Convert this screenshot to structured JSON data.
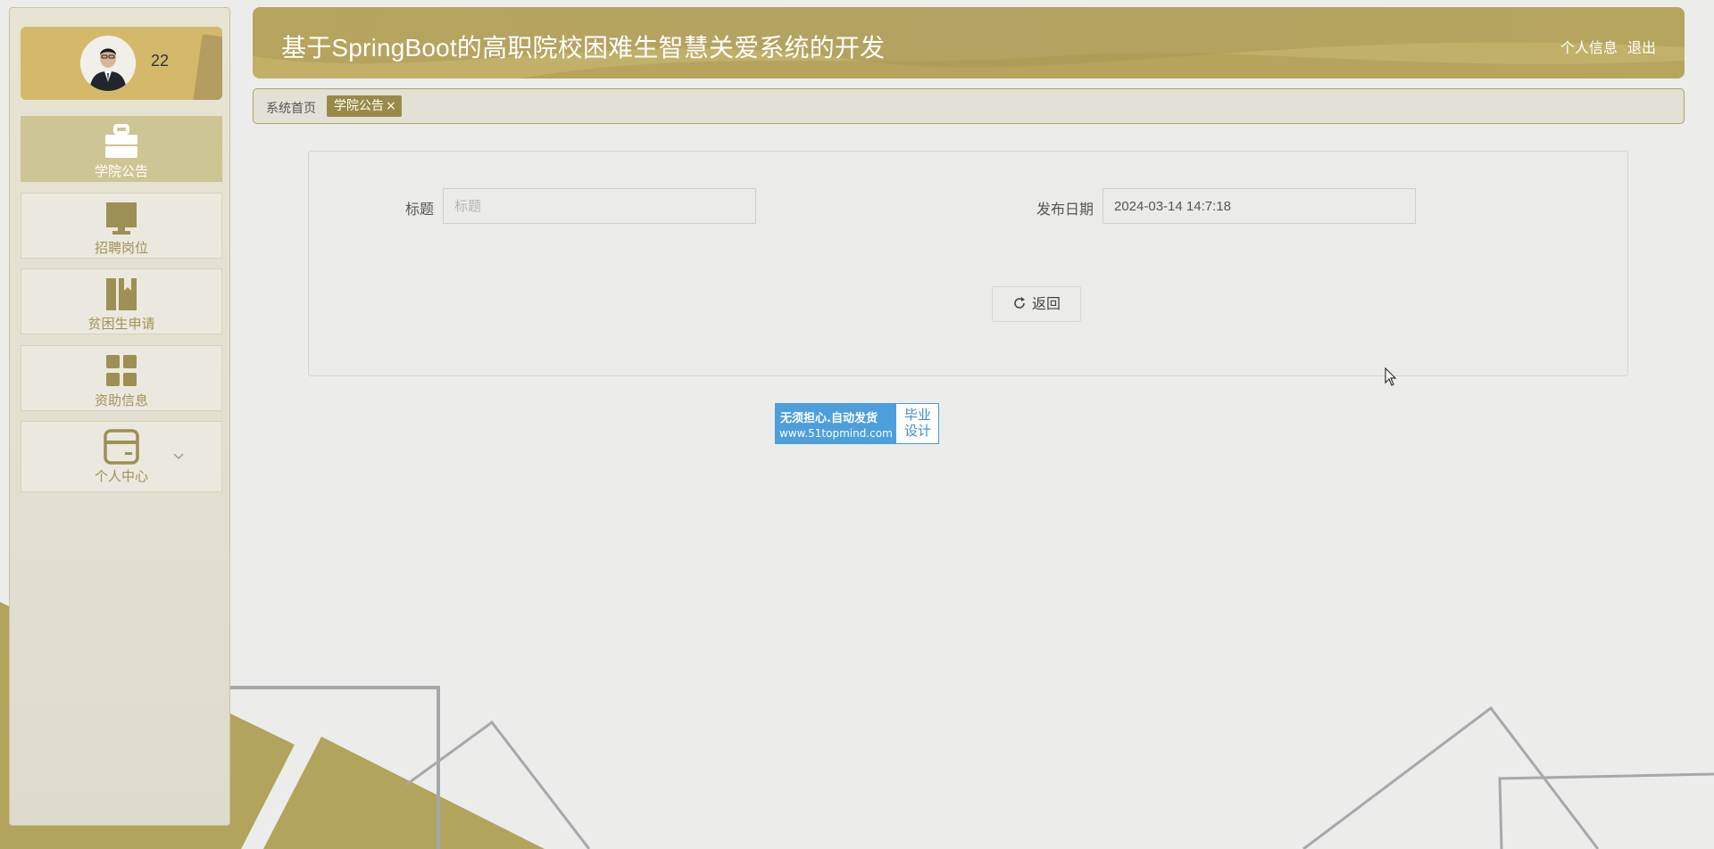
{
  "app": {
    "title": "基于SpringBoot的高职院校困难生智慧关爱系统的开发",
    "header_links": {
      "profile": "个人信息",
      "logout": "退出"
    }
  },
  "user": {
    "name": "22"
  },
  "sidebar": {
    "items": [
      {
        "label": "学院公告",
        "icon": "briefcase-icon",
        "active": true
      },
      {
        "label": "招聘岗位",
        "icon": "monitor-icon",
        "active": false
      },
      {
        "label": "贫困生申请",
        "icon": "books-icon",
        "active": false
      },
      {
        "label": "资助信息",
        "icon": "grid-icon",
        "active": false
      },
      {
        "label": "个人中心",
        "icon": "card-icon",
        "active": false,
        "has_submenu": true
      }
    ]
  },
  "tabs": {
    "home": "系统首页",
    "active": "学院公告",
    "close": "×"
  },
  "form": {
    "title_label": "标题",
    "title_value": "",
    "title_placeholder": "标题",
    "date_label": "发布日期",
    "date_value": "2024-03-14 14:7:18",
    "back_button": "返回"
  },
  "badge": {
    "line1": "无须担心.自动发货",
    "line2": "www.51topmind.com",
    "right_line1": "毕业",
    "right_line2": "设计"
  },
  "colors": {
    "accent": "#b3a261",
    "active_tab": "#9a8a48",
    "sidebar_active": "#cec594",
    "menu_text": "#a09256",
    "background": "#ececeb"
  }
}
